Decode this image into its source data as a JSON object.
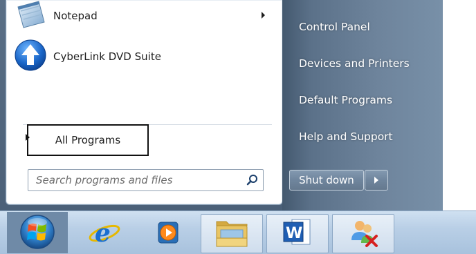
{
  "start_menu": {
    "programs": [
      {
        "label": "Notepad",
        "icon": "notepad-icon",
        "has_submenu": true
      },
      {
        "label": "CyberLink DVD Suite",
        "icon": "cyberlink-dvd-suite-icon",
        "has_submenu": false
      }
    ],
    "all_programs_label": "All Programs",
    "search": {
      "placeholder": "Search programs and files",
      "value": ""
    },
    "right_links": [
      "Control Panel",
      "Devices and Printers",
      "Default Programs",
      "Help and Support"
    ],
    "shutdown_label": "Shut down"
  },
  "taskbar": {
    "items": [
      {
        "icon": "windows-start-orb-icon"
      },
      {
        "icon": "internet-explorer-icon"
      },
      {
        "icon": "windows-media-player-icon"
      },
      {
        "icon": "windows-explorer-icon"
      },
      {
        "icon": "microsoft-word-icon"
      },
      {
        "icon": "users-icon"
      }
    ]
  },
  "colors": {
    "menu_frame": "#4f657c",
    "right_pane": "#6e849c",
    "taskbar": "#b9cfe6",
    "text_dark": "#1e1e1e",
    "text_light": "#ffffff"
  }
}
